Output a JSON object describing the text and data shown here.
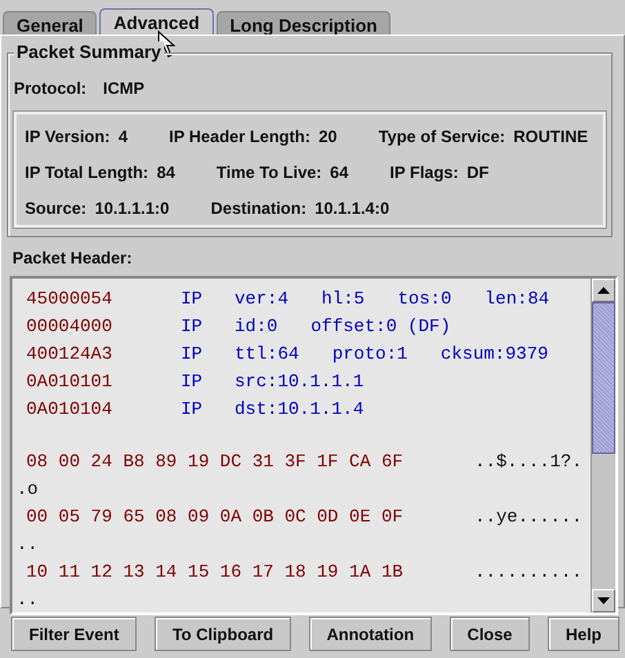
{
  "tabs": [
    {
      "label": "General",
      "selected": false
    },
    {
      "label": "Advanced",
      "selected": true
    },
    {
      "label": "Long Description",
      "selected": false
    }
  ],
  "summary": {
    "title": "Packet Summary",
    "protocol_label": "Protocol:",
    "protocol_value": "ICMP",
    "rows": [
      [
        {
          "label": "IP Version:",
          "value": "4"
        },
        {
          "label": "IP Header Length:",
          "value": "20"
        },
        {
          "label": "Type of Service:",
          "value": "ROUTINE"
        }
      ],
      [
        {
          "label": "IP Total Length:",
          "value": "84"
        },
        {
          "label": "Time To Live:",
          "value": "64"
        },
        {
          "label": "IP Flags:",
          "value": "DF"
        }
      ],
      [
        {
          "label": "Source:",
          "value": "10.1.1.1:0"
        },
        {
          "label": "Destination:",
          "value": "10.1.1.4:0"
        }
      ]
    ]
  },
  "header": {
    "title": "Packet Header:",
    "rows": [
      {
        "hex": "45000054",
        "proto": "IP",
        "fields": [
          "ver:4",
          "hl:5",
          "tos:0",
          "len:84"
        ]
      },
      {
        "hex": "00004000",
        "proto": "IP",
        "fields": [
          "id:0",
          "offset:0 (DF)"
        ]
      },
      {
        "hex": "400124A3",
        "proto": "IP",
        "fields": [
          "ttl:64",
          "proto:1",
          "cksum:9379"
        ]
      },
      {
        "hex": "0A010101",
        "proto": "IP",
        "fields": [
          "src:10.1.1.1"
        ]
      },
      {
        "hex": "0A010104",
        "proto": "IP",
        "fields": [
          "dst:10.1.1.4"
        ]
      }
    ],
    "dump": [
      {
        "bytes": "08 00 24 B8 89 19 DC 31 3F 1F CA 6F",
        "ascii": "..$....1?.",
        "wrap": ".o"
      },
      {
        "bytes": "00 05 79 65 08 09 0A 0B 0C 0D 0E 0F",
        "ascii": "..ye......",
        "wrap": ".."
      },
      {
        "bytes": "10 11 12 13 14 15 16 17 18 19 1A 1B",
        "ascii": "..........",
        "wrap": ".."
      }
    ]
  },
  "buttons": [
    "Filter Event",
    "To Clipboard",
    "Annotation",
    "Close",
    "Help"
  ]
}
